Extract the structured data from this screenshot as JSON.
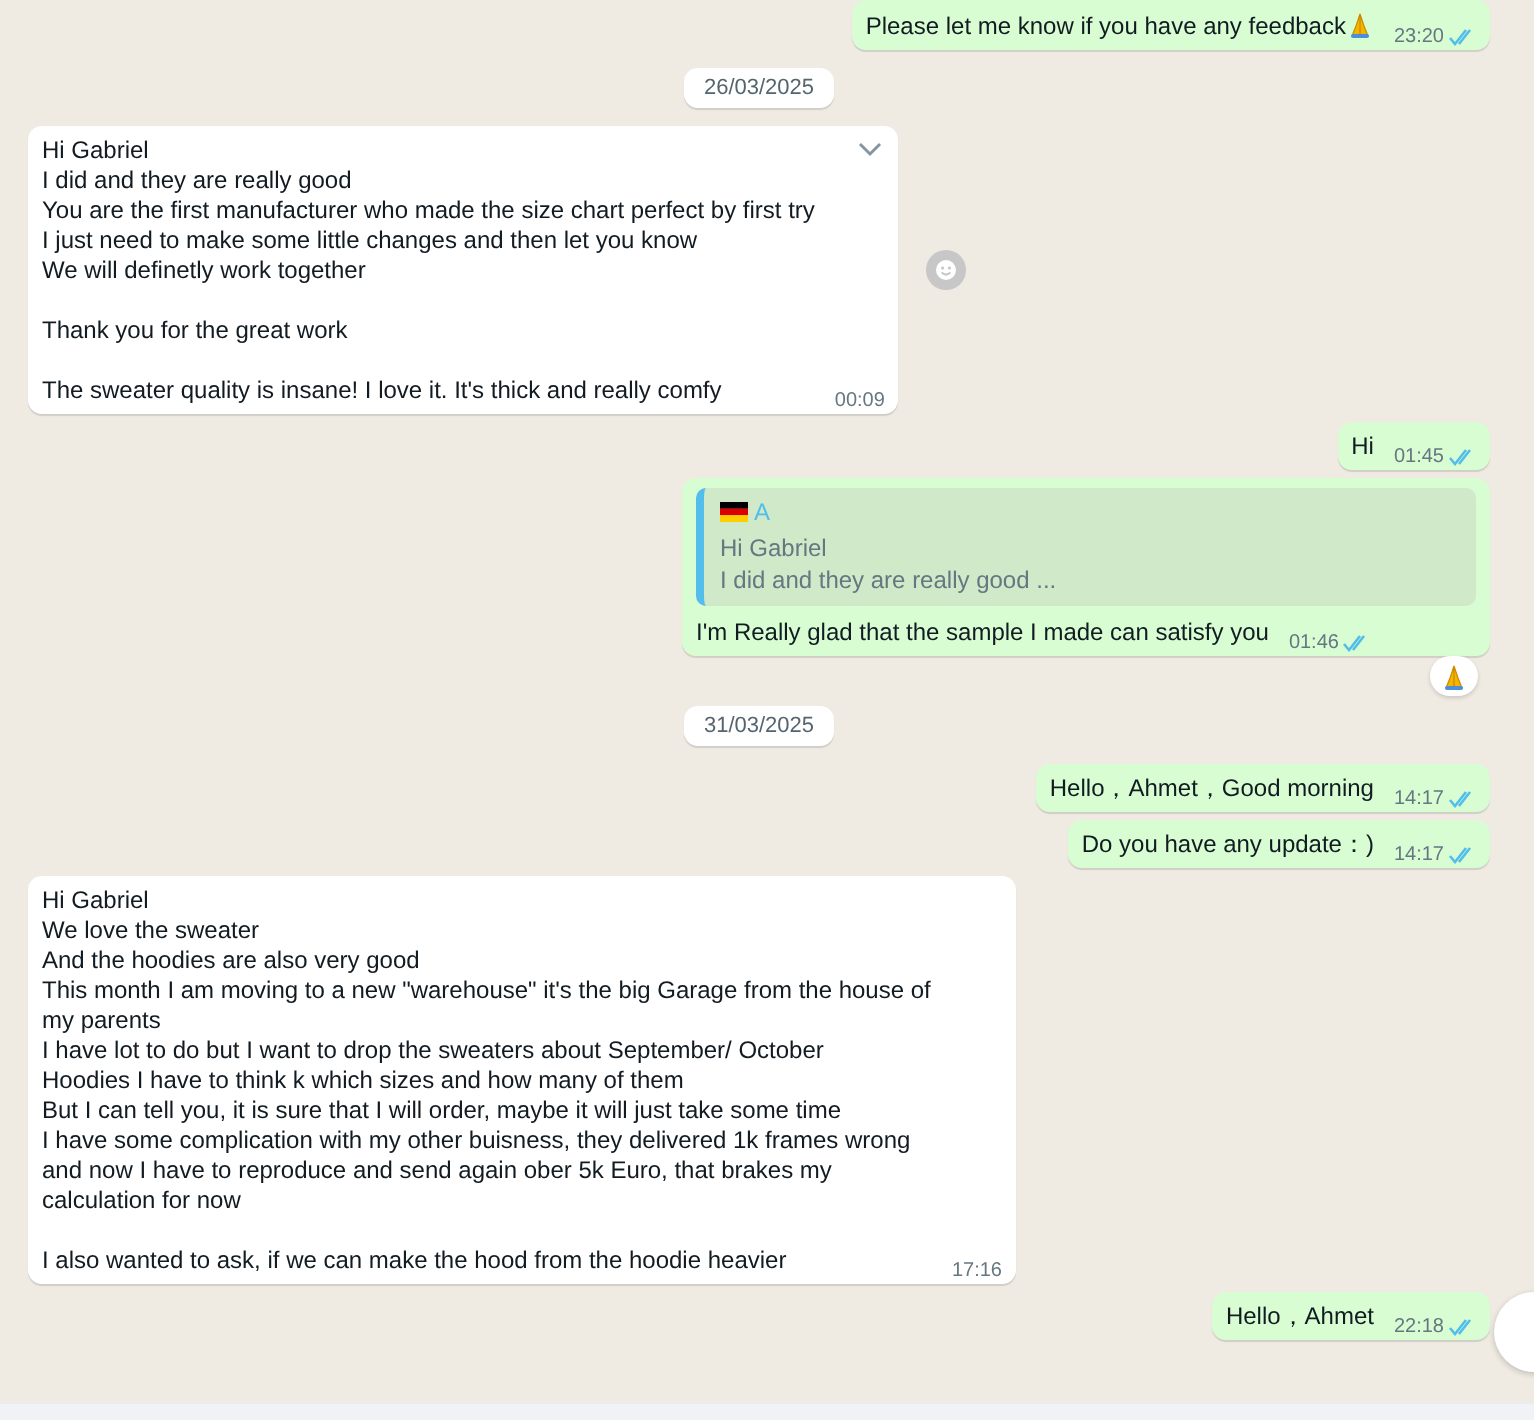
{
  "messages": [
    {
      "kind": "out",
      "text": "Please let me know if you have any feedback",
      "emoji": true,
      "time": "23:20",
      "read": true
    },
    {
      "kind": "date",
      "text": "26/03/2025"
    },
    {
      "kind": "in",
      "text": "Hi Gabriel\nI did and they are really good\nYou are the first manufacturer who made the size chart perfect by first try\nI just need to make some little changes and then let you know\nWe will definetly work together\n\nThank you for the great work\n\nThe sweater quality is insane! I love it. It's thick and really comfy",
      "time": "00:09",
      "menu": true,
      "react_button": true
    },
    {
      "kind": "out",
      "text": "Hi",
      "time": "01:45",
      "read": true
    },
    {
      "kind": "out",
      "quote": {
        "author": "A",
        "lines": "Hi Gabriel\nI did and they are really good ..."
      },
      "text": "I'm Really glad that the sample I made can satisfy you",
      "time": "01:46",
      "read": true,
      "reacted": true
    },
    {
      "kind": "date",
      "text": "31/03/2025"
    },
    {
      "kind": "out",
      "text": "Hello，Ahmet，Good morning",
      "time": "14:17",
      "read": true
    },
    {
      "kind": "out",
      "text": "Do you have any update：)",
      "time": "14:17",
      "read": true
    },
    {
      "kind": "in",
      "text": "Hi Gabriel\nWe love the sweater\nAnd the hoodies are also very good\nThis month I am moving to a new \"warehouse\" it's the big Garage from the house of my parents\nI have lot to do but I want to drop the sweaters about September/ October\nHoodies I have to think k which sizes and how many of them\nBut I can tell you, it is sure that I will order, maybe it will just take some time\nI have some complication with my other buisness, they delivered 1k frames wrong and now I have to reproduce and send again ober 5k Euro, that brakes my calculation for now\n\nI also wanted to ask, if we can make the hood from the hoodie heavier",
      "time": "17:16"
    },
    {
      "kind": "out",
      "text": "Hello，Ahmet",
      "time": "22:18",
      "read": true
    }
  ]
}
